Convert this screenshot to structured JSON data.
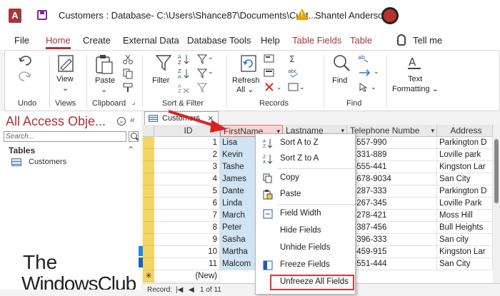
{
  "window": {
    "title": "Customers : Database- C:\\Users\\Shance87\\Documents\\Cust...",
    "user": "Shantel Anderson",
    "app_letter": "A"
  },
  "menu": {
    "items": [
      {
        "label": "File",
        "name": "menu-file"
      },
      {
        "label": "Home",
        "name": "menu-home",
        "active": true
      },
      {
        "label": "Create",
        "name": "menu-create"
      },
      {
        "label": "External Data",
        "name": "menu-external-data"
      },
      {
        "label": "Database Tools",
        "name": "menu-database-tools"
      },
      {
        "label": "Help",
        "name": "menu-help"
      },
      {
        "label": "Table Fields",
        "name": "menu-table-fields",
        "context": true
      },
      {
        "label": "Table",
        "name": "menu-table",
        "context": true
      },
      {
        "label": "Tell me",
        "name": "menu-tell-me"
      }
    ]
  },
  "ribbon": {
    "groups": [
      "Undo",
      "Views",
      "Clipboard",
      "Sort & Filter",
      "Records",
      "Find"
    ],
    "buttons": {
      "view": "View",
      "paste": "Paste",
      "filter": "Filter",
      "refresh": "Refresh",
      "refresh_all": "All",
      "find": "Find",
      "text": "Text",
      "formatting": "Formatting"
    }
  },
  "nav": {
    "title": "All Access Obje...",
    "search_placeholder": "Search...",
    "section": "Tables",
    "items": [
      "Customers"
    ]
  },
  "watermark": {
    "line1": "The",
    "line2": "WindowsClub"
  },
  "document": {
    "tab": "Customers",
    "columns": [
      "ID",
      "FirstName",
      "Lastname",
      "Telephone Numbe",
      "Address"
    ],
    "rows": [
      {
        "id": "1",
        "first": "Lisa",
        "phone": "0-557-990",
        "address": "Parkington D"
      },
      {
        "id": "2",
        "first": "Kevin",
        "phone": "0-331-889",
        "address": "Loville park"
      },
      {
        "id": "3",
        "first": "Tashe",
        "phone": "0-555-441",
        "address": "Kingston Lar"
      },
      {
        "id": "4",
        "first": "James",
        "phone": "0-678-9034",
        "address": "San City"
      },
      {
        "id": "5",
        "first": "Dante",
        "phone": "0-287-333",
        "address": "Parkington D"
      },
      {
        "id": "6",
        "first": "Linda",
        "phone": "0-267-345",
        "address": "Loville Park"
      },
      {
        "id": "7",
        "first": "March",
        "phone": "0-278-421",
        "address": "Moss Hill"
      },
      {
        "id": "8",
        "first": "Peter",
        "phone": "0-387-456",
        "address": "Bull Heights"
      },
      {
        "id": "9",
        "first": "Sasha",
        "phone": "0-396-333",
        "address": "San city"
      },
      {
        "id": "10",
        "first": "Martha",
        "phone": "0-459-915",
        "address": "Kingston Lar"
      },
      {
        "id": "11",
        "first": "Malcom",
        "phone": "0-551-444",
        "address": "San City"
      }
    ],
    "new_row": "(New)",
    "record_label": "Record:",
    "record_pos": "1 of 11"
  },
  "context_menu": {
    "items": [
      {
        "label": "Sort A to Z",
        "icon": "sort-az-icon"
      },
      {
        "label": "Sort Z to A",
        "icon": "sort-za-icon"
      },
      {
        "label": "Copy",
        "icon": "copy-icon"
      },
      {
        "label": "Paste",
        "icon": "paste-icon"
      },
      {
        "label": "Field Width",
        "icon": "field-width-icon"
      },
      {
        "label": "Hide Fields",
        "icon": ""
      },
      {
        "label": "Unhide Fields",
        "icon": ""
      },
      {
        "label": "Freeze Fields",
        "icon": "freeze-icon"
      },
      {
        "label": "Unfreeze All Fields",
        "icon": "",
        "highlighted": true
      }
    ]
  },
  "colors": {
    "accent": "#a4373a",
    "selection": "#cfe4f5",
    "row_selector": "#f4d565",
    "annotation": "#e02020"
  }
}
